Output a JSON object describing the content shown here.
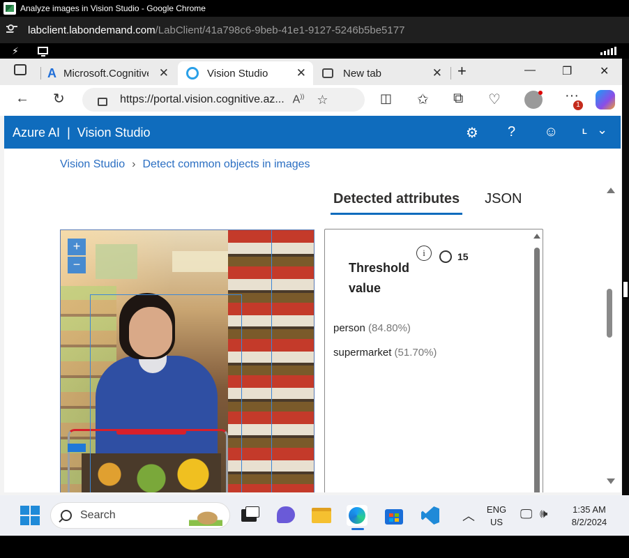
{
  "outer_window": {
    "title": "Analyze images in Vision Studio - Google Chrome",
    "url_host": "labclient.labondemand.com",
    "url_path": "/LabClient/41a798c6-9beb-41e1-9127-5246b5be5177"
  },
  "edge": {
    "tabs": [
      {
        "label": "Microsoft.Cognitive",
        "icon": "azure-icon"
      },
      {
        "label": "Vision Studio",
        "icon": "vision-studio-icon",
        "active": true
      },
      {
        "label": "New tab",
        "icon": "new-tab-icon"
      }
    ],
    "address": "https://portal.vision.cognitive.az..."
  },
  "app": {
    "brand": "Azure AI",
    "product": "Vision Studio",
    "avatar_letter": "L",
    "breadcrumb": [
      "Vision Studio",
      "Detect common objects in images"
    ],
    "result_tabs": [
      "Detected attributes",
      "JSON"
    ],
    "threshold_label": "Threshold value",
    "threshold_value": "15",
    "attributes": [
      {
        "name": "person",
        "confidence": "(84.80%)"
      },
      {
        "name": "supermarket",
        "confidence": "(51.70%)"
      }
    ],
    "zoom_in": "+",
    "zoom_out": "−"
  },
  "taskbar": {
    "search_placeholder": "Search",
    "lang_line1": "ENG",
    "lang_line2": "US",
    "time": "1:35 AM",
    "date": "8/2/2024",
    "notification_count": "1"
  },
  "colors": {
    "azure_header": "#0f6cbd",
    "link": "#2a6ec2",
    "bbox": "#3b87d8"
  }
}
